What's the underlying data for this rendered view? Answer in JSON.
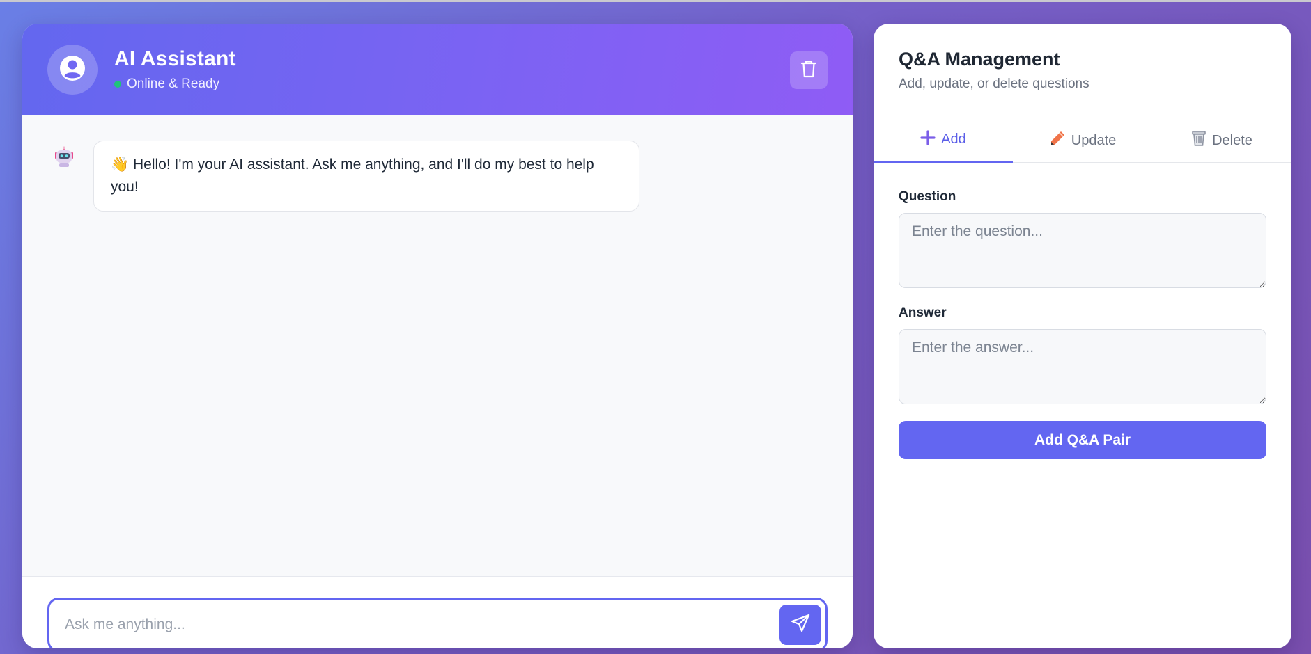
{
  "chat": {
    "header": {
      "title": "AI Assistant",
      "status": "Online & Ready",
      "status_color": "#1fc37a"
    },
    "messages": [
      {
        "sender": "bot",
        "avatar_icon": "robot-icon",
        "text": "👋 Hello! I'm your AI assistant. Ask me anything, and I'll do my best to help you!"
      }
    ],
    "input": {
      "placeholder": "Ask me anything...",
      "value": ""
    },
    "icons": {
      "avatar": "user-circle-icon",
      "clear": "trash-icon",
      "send": "paper-plane-icon"
    }
  },
  "qa": {
    "title": "Q&A Management",
    "subtitle": "Add, update, or delete questions",
    "tabs": [
      {
        "label": "Add",
        "icon": "plus-icon",
        "active": true
      },
      {
        "label": "Update",
        "icon": "pencil-icon",
        "active": false
      },
      {
        "label": "Delete",
        "icon": "wastebasket-icon",
        "active": false
      }
    ],
    "form": {
      "question_label": "Question",
      "question_placeholder": "Enter the question...",
      "answer_label": "Answer",
      "answer_placeholder": "Enter the answer...",
      "submit_label": "Add Q&A Pair"
    }
  },
  "colors": {
    "accent": "#6366f1",
    "header_gradient_start": "#6367ef",
    "header_gradient_end": "#8f5cf5"
  }
}
